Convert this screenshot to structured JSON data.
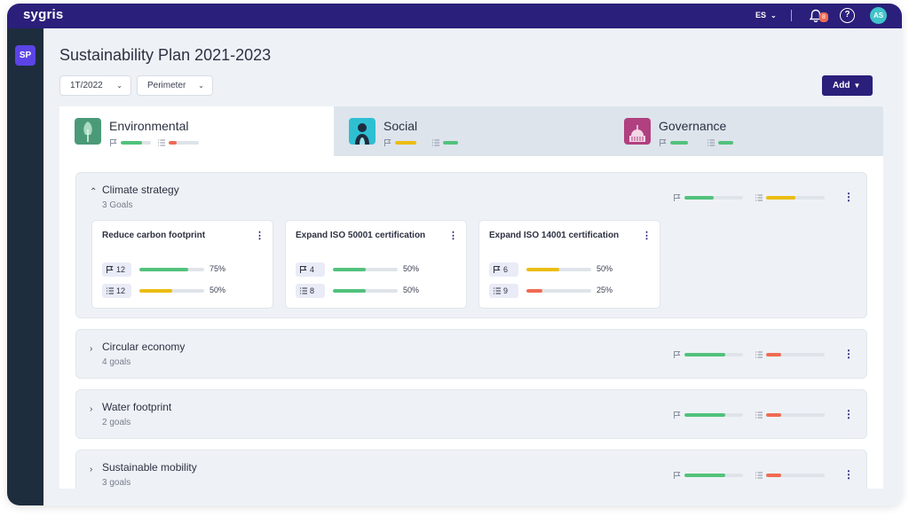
{
  "app": {
    "logo": "sygris",
    "language": "ES",
    "notification_count": "8",
    "help": "?",
    "user_initials": "AS",
    "sidebar_badge": "SP"
  },
  "page": {
    "title": "Sustainability Plan 2021-2023"
  },
  "filters": {
    "period": "1T/2022",
    "perimeter": "Perimeter"
  },
  "actions": {
    "add_label": "Add"
  },
  "colors": {
    "green": "#52c27c",
    "yellow": "#ebbd12",
    "red": "#f06b53",
    "brand": "#2a1f7a"
  },
  "tabs": [
    {
      "label": "Environmental",
      "icon": "tree-icon",
      "goals_progress": 0.7,
      "goals_color": "green",
      "actions_progress": 0.25,
      "actions_color": "red"
    },
    {
      "label": "Social",
      "icon": "person-icon",
      "goals_progress": 0.7,
      "goals_color": "yellow",
      "actions_progress": 0.5,
      "actions_color": "green"
    },
    {
      "label": "Governance",
      "icon": "capitol-icon",
      "goals_progress": 0.6,
      "goals_color": "green",
      "actions_progress": 0.5,
      "actions_color": "green"
    }
  ],
  "groups": [
    {
      "name": "Climate strategy",
      "count": "3 Goals",
      "expanded": true,
      "goals_progress": 0.5,
      "goals_color": "green",
      "actions_progress": 0.5,
      "actions_color": "yellow",
      "cards": [
        {
          "name": "Reduce carbon footprint",
          "goals": "12",
          "goals_pct": "75%",
          "goals_value": 0.75,
          "goals_color": "green",
          "actions": "12",
          "actions_pct": "50%",
          "actions_value": 0.5,
          "actions_color": "yellow"
        },
        {
          "name": "Expand ISO 50001 certification",
          "goals": "4",
          "goals_pct": "50%",
          "goals_value": 0.5,
          "goals_color": "green",
          "actions": "8",
          "actions_pct": "50%",
          "actions_value": 0.5,
          "actions_color": "green"
        },
        {
          "name": "Expand ISO 14001 certification",
          "goals": "6",
          "goals_pct": "50%",
          "goals_value": 0.5,
          "goals_color": "yellow",
          "actions": "9",
          "actions_pct": "25%",
          "actions_value": 0.25,
          "actions_color": "red"
        }
      ]
    },
    {
      "name": "Circular economy",
      "count": "4 goals",
      "expanded": false,
      "goals_progress": 0.7,
      "goals_color": "green",
      "actions_progress": 0.25,
      "actions_color": "red"
    },
    {
      "name": "Water footprint",
      "count": "2 goals",
      "expanded": false,
      "goals_progress": 0.7,
      "goals_color": "green",
      "actions_progress": 0.25,
      "actions_color": "red"
    },
    {
      "name": "Sustainable mobility",
      "count": "3 goals",
      "expanded": false,
      "goals_progress": 0.7,
      "goals_color": "green",
      "actions_progress": 0.25,
      "actions_color": "red"
    }
  ]
}
